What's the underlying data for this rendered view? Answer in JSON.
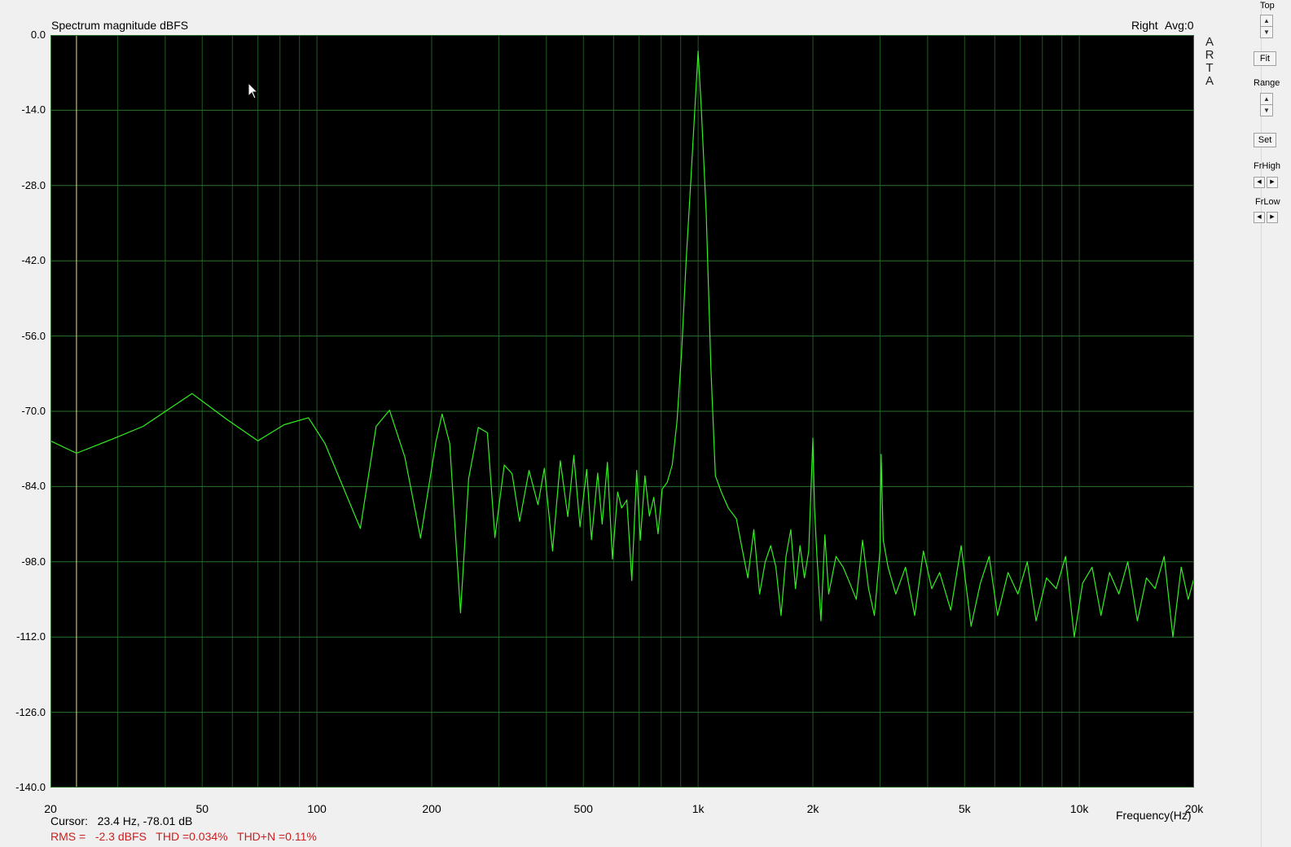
{
  "chart_data": {
    "type": "line",
    "title": "Spectrum magnitude dBFS",
    "channel": "Right",
    "avg": "Avg:0",
    "xlabel": "Frequency(Hz)",
    "x_scale": "log",
    "xlim": [
      20,
      20000
    ],
    "ylim": [
      -140,
      0
    ],
    "y_ticks": [
      "0.0",
      "-14.0",
      "-28.0",
      "-42.0",
      "-56.0",
      "-70.0",
      "-84.0",
      "-98.0",
      "-112.0",
      "-126.0",
      "-140.0"
    ],
    "x_ticks": [
      {
        "v": 20,
        "label": "20"
      },
      {
        "v": 50,
        "label": "50"
      },
      {
        "v": 100,
        "label": "100"
      },
      {
        "v": 200,
        "label": "200"
      },
      {
        "v": 500,
        "label": "500"
      },
      {
        "v": 1000,
        "label": "1k"
      },
      {
        "v": 2000,
        "label": "2k"
      },
      {
        "v": 5000,
        "label": "5k"
      },
      {
        "v": 10000,
        "label": "10k"
      },
      {
        "v": 20000,
        "label": "20k"
      }
    ],
    "grid": true,
    "cursor_hz": 23.4,
    "line_color": "#33ee22",
    "background_color": "#000000",
    "grid_color": "#1f5a1f",
    "cursor_line_color": "#e8e080",
    "series": [
      {
        "x": [
          20,
          23.4,
          29,
          35,
          47,
          58,
          70,
          82,
          95,
          105,
          130,
          143,
          155,
          170,
          187,
          205,
          213,
          223,
          238,
          250,
          265,
          280,
          293,
          310,
          325,
          340,
          360,
          380,
          395,
          415,
          435,
          455,
          472,
          490,
          510,
          525,
          545,
          560,
          578,
          596,
          615,
          630,
          650,
          670,
          690,
          705,
          725,
          745,
          765,
          785,
          805,
          830,
          855,
          880,
          905,
          930,
          955,
          980,
          1000,
          1020,
          1050,
          1080,
          1110,
          1150,
          1200,
          1260,
          1300,
          1350,
          1400,
          1450,
          1500,
          1550,
          1600,
          1650,
          1700,
          1750,
          1800,
          1850,
          1900,
          1950,
          2000,
          2020,
          2050,
          2100,
          2150,
          2200,
          2300,
          2400,
          2500,
          2600,
          2700,
          2800,
          2900,
          3000,
          3020,
          3060,
          3150,
          3300,
          3500,
          3700,
          3900,
          4100,
          4300,
          4600,
          4900,
          5200,
          5500,
          5800,
          6100,
          6500,
          6900,
          7300,
          7700,
          8200,
          8700,
          9200,
          9700,
          10200,
          10800,
          11400,
          12000,
          12700,
          13400,
          14200,
          15000,
          15800,
          16700,
          17600,
          18500,
          19300,
          20000
        ],
        "y": [
          -75.5,
          -77.8,
          -75.2,
          -72.8,
          -66.7,
          -71.5,
          -75.5,
          -72.5,
          -71.2,
          -76,
          -91.8,
          -72.8,
          -69.8,
          -78.5,
          -93.6,
          -75.8,
          -70.5,
          -76,
          -107.5,
          -82.5,
          -73,
          -74,
          -93.5,
          -80,
          -81.6,
          -90.5,
          -81,
          -87.4,
          -80.6,
          -96,
          -79.2,
          -89.6,
          -78.2,
          -91.5,
          -80.8,
          -93.9,
          -81.5,
          -91,
          -79.5,
          -97.5,
          -85,
          -88,
          -86.5,
          -101.5,
          -81,
          -94,
          -82,
          -89.5,
          -86,
          -92.8,
          -84.5,
          -83.2,
          -80,
          -72,
          -59,
          -42,
          -28,
          -14,
          -3,
          -14,
          -33,
          -62,
          -82,
          -85,
          -88,
          -90,
          -95,
          -101,
          -92,
          -104,
          -98,
          -95,
          -99,
          -108,
          -97,
          -92,
          -103,
          -95,
          -101,
          -96,
          -75,
          -88,
          -97,
          -109,
          -93,
          -104,
          -97,
          -99,
          -102,
          -105,
          -94,
          -103,
          -108,
          -96,
          -78,
          -94,
          -99,
          -104,
          -99,
          -108,
          -96,
          -103,
          -100,
          -107,
          -95,
          -110,
          -102,
          -97,
          -108,
          -100,
          -104,
          -98,
          -109,
          -101,
          -103,
          -97,
          -112,
          -102,
          -99,
          -108,
          -100,
          -104,
          -98,
          -109,
          -101,
          -103,
          -97,
          -112,
          -99,
          -105,
          -101
        ]
      }
    ]
  },
  "cursor_readout": {
    "label": "Cursor:",
    "value": "23.4 Hz, -78.01 dB"
  },
  "stats": "RMS =   -2.3 dBFS   THD =0.034%   THD+N =0.11%",
  "watermark": [
    "A",
    "R",
    "T",
    "A"
  ],
  "side_panel": {
    "top_label": "Top",
    "fit_label": "Fit",
    "range_label": "Range",
    "set_label": "Set",
    "frhigh_label": "FrHigh",
    "frlow_label": "FrLow"
  }
}
